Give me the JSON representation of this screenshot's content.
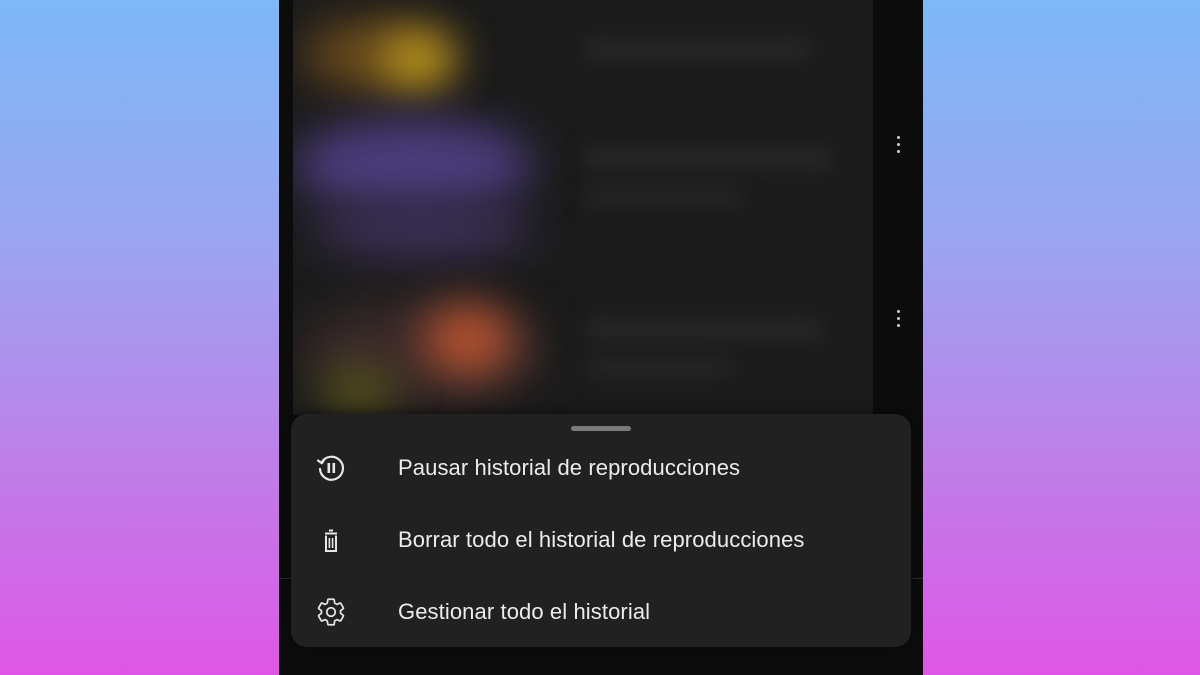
{
  "menu": {
    "items": [
      {
        "label": "Pausar historial de reproducciones",
        "icon": "pause-history-icon"
      },
      {
        "label": "Borrar todo el historial de reproducciones",
        "icon": "trash-icon"
      },
      {
        "label": "Gestionar todo el historial",
        "icon": "gear-icon"
      }
    ]
  },
  "colors": {
    "background_top": "#7db8f7",
    "background_bottom": "#df56e6",
    "phone_bg": "#0c0c0c",
    "sheet_bg": "#212121",
    "text": "#ececec"
  }
}
